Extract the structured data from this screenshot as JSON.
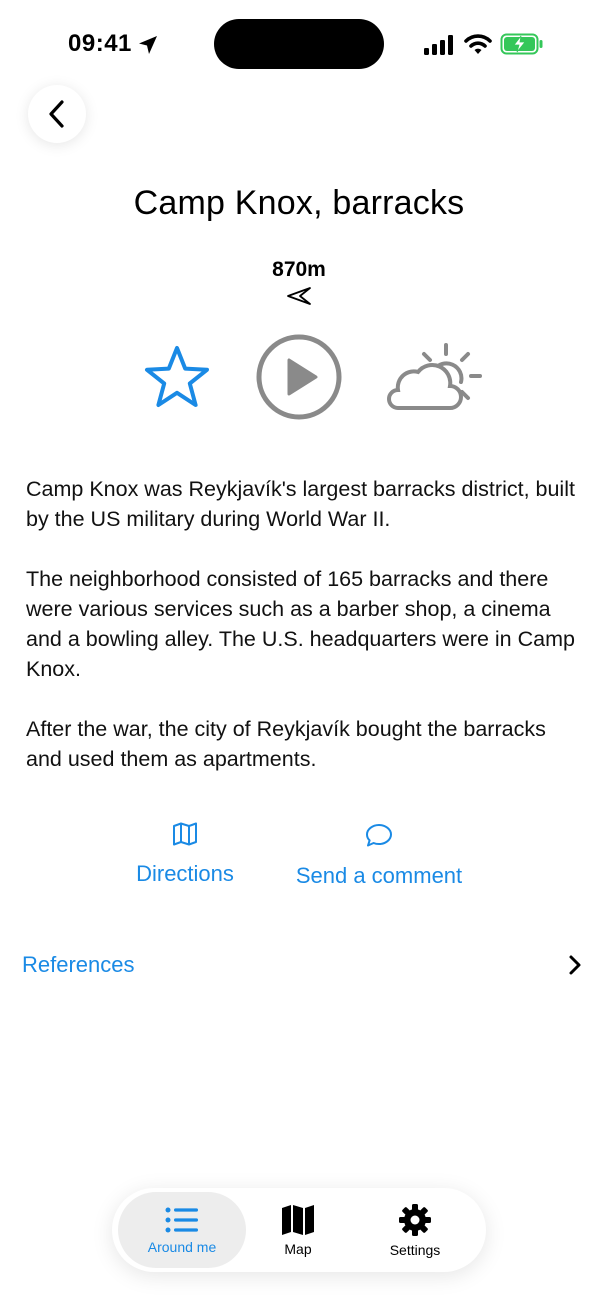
{
  "status_bar": {
    "time": "09:41",
    "icons": [
      "location-arrow-icon",
      "cellular-signal-icon",
      "wifi-icon",
      "battery-charging-icon"
    ]
  },
  "header": {
    "back_icon": "chevron-left-icon",
    "title": "Camp Knox, barracks",
    "distance": "870m",
    "bearing_icon": "direction-arrow-icon"
  },
  "media_controls": {
    "favorite_icon": "star-outline-icon",
    "play_icon": "play-circle-icon",
    "weather_icon": "partly-sunny-icon"
  },
  "description": {
    "paragraphs": [
      "Camp Knox was Reykjavík's largest barracks district, built by the US military during World War II.",
      "The neighborhood consisted of 165 barracks and there were various services such as a barber shop, a cinema and a bowling alley. The U.S. headquarters were in Camp Knox.",
      "After the war, the city of Reykjavík bought the barracks and used them as apartments."
    ]
  },
  "actions": {
    "directions": {
      "label": "Directions",
      "icon": "map-outline-icon"
    },
    "comment": {
      "label": "Send a comment",
      "icon": "chat-bubble-icon"
    }
  },
  "references": {
    "label": "References",
    "icon": "chevron-right-icon"
  },
  "tab_bar": {
    "tabs": [
      {
        "label": "Around me",
        "icon": "list-icon",
        "active": true
      },
      {
        "label": "Map",
        "icon": "map-icon",
        "active": false
      },
      {
        "label": "Settings",
        "icon": "gear-icon",
        "active": false
      }
    ]
  },
  "colors": {
    "accent": "#1a8ae5",
    "star": "#1a8ae5",
    "play": "#8a8a8a",
    "weather": "#8a8a8a",
    "battery": "#34c759"
  }
}
